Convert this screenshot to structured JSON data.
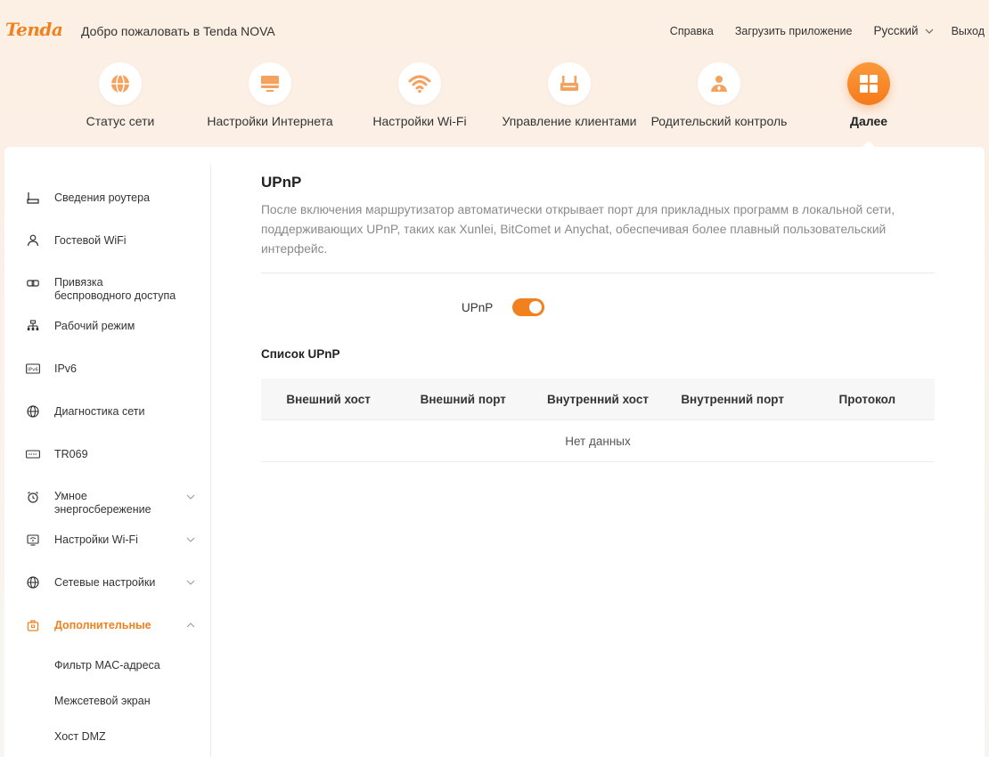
{
  "header": {
    "logo": "Tenda",
    "welcome": "Добро пожаловать в Tenda NOVA",
    "help": "Справка",
    "download_app": "Загрузить приложение",
    "language": "Русский",
    "logout": "Выход"
  },
  "nav": {
    "items": [
      {
        "label": "Статус сети",
        "icon": "globe-icon"
      },
      {
        "label": "Настройки Интернета",
        "icon": "internet-monitor-icon"
      },
      {
        "label": "Настройки Wi-Fi",
        "icon": "wifi-icon"
      },
      {
        "label": "Управление клиентами",
        "icon": "router-clients-icon"
      },
      {
        "label": "Родительский контроль",
        "icon": "parental-control-icon"
      },
      {
        "label": "Далее",
        "icon": "grid-more-icon"
      }
    ],
    "active_index": 5
  },
  "sidebar": {
    "items": [
      {
        "label": "Сведения роутера",
        "icon": "router-info-icon"
      },
      {
        "label": "Гостевой WiFi",
        "icon": "guest-user-icon"
      },
      {
        "label": "Привязка",
        "label2": "беспроводного доступа",
        "icon": "link-icon"
      },
      {
        "label": "Рабочий режим",
        "icon": "network-tree-icon"
      },
      {
        "label": "IPv6",
        "icon": "ipv6-icon"
      },
      {
        "label": "Диагностика сети",
        "icon": "globe-icon"
      },
      {
        "label": "TR069",
        "icon": "tr069-icon"
      },
      {
        "label": "Умное",
        "label2": "энергосбережение",
        "icon": "alarm-clock-icon",
        "expandable": true
      },
      {
        "label": "Настройки Wi-Fi",
        "icon": "wifi-settings-icon",
        "expandable": true
      },
      {
        "label": "Сетевые настройки",
        "icon": "globe-icon",
        "expandable": true
      },
      {
        "label": "Дополнительные",
        "icon": "toolbox-icon",
        "expandable": true,
        "expanded": true
      }
    ],
    "sub_items": [
      "Фильтр MAC-адреса",
      "Межсетевой экран",
      "Хост DMZ"
    ]
  },
  "main": {
    "title": "UPnP",
    "description": "После включения маршрутизатор автоматически открывает порт для прикладных программ в локальной сети, поддерживающих UPnP, таких как Xunlei, BitComet и Anychat, обеспечивая более плавный пользовательский интерфейс.",
    "toggle_label": "UPnP",
    "toggle_on": true,
    "list_title": "Список UPnP",
    "table": {
      "columns": [
        "Внешний хост",
        "Внешний порт",
        "Внутренний хост",
        "Внутренний порт",
        "Протокол"
      ],
      "rows": [],
      "empty_text": "Нет данных"
    }
  },
  "colors": {
    "accent": "#f0811e",
    "text": "#333333",
    "muted": "#8a8a8a"
  }
}
